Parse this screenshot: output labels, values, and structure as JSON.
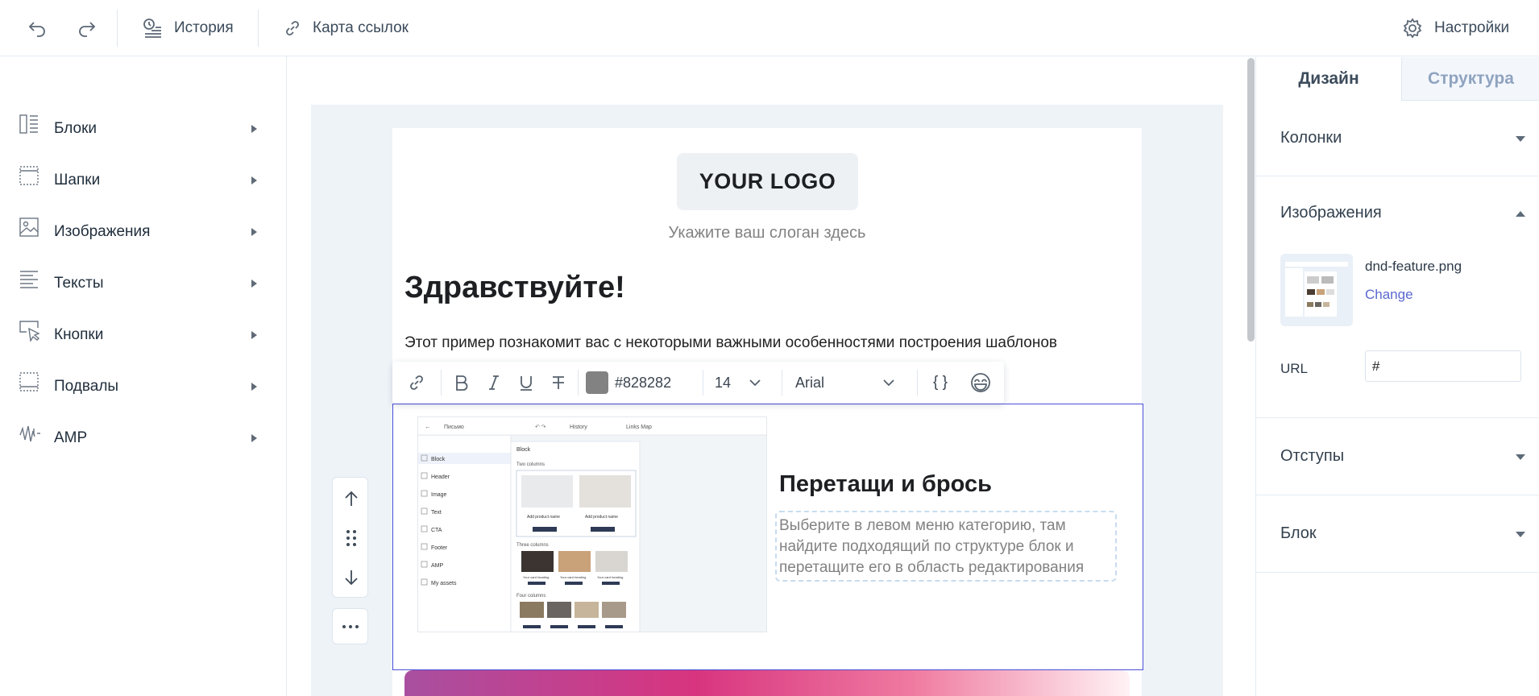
{
  "toolbar": {
    "undo_icon": "undo-icon",
    "redo_icon": "redo-icon",
    "history_label": "История",
    "links_map_label": "Карта ссылок",
    "settings_label": "Настройки"
  },
  "sidebar": {
    "items": [
      {
        "label": "Блоки",
        "icon": "blocks-icon"
      },
      {
        "label": "Шапки",
        "icon": "header-icon"
      },
      {
        "label": "Изображения",
        "icon": "image-icon"
      },
      {
        "label": "Тексты",
        "icon": "text-icon"
      },
      {
        "label": "Кнопки",
        "icon": "button-icon"
      },
      {
        "label": "Подвалы",
        "icon": "footer-icon"
      },
      {
        "label": "AMP",
        "icon": "amp-icon"
      }
    ]
  },
  "email": {
    "logo_text": "YOUR LOGO",
    "slogan": "Укажите ваш слоган здесь",
    "greeting": "Здравствуйте!",
    "intro": "Этот пример познакомит вас с некоторыми важными особенностями построения шаблонов",
    "dnd_title": "Перетащи и брось",
    "dnd_text": "Выберите в левом меню категорию, там найдите подходящий по структуре блок и перетащите его в область редактирования"
  },
  "text_toolbar": {
    "color_value": "#828282",
    "swatch_color": "#828282",
    "font_size": "14",
    "font_family": "Arial",
    "merge_tags_label": "{ }"
  },
  "preview_shot": {
    "title": "Письмо",
    "history": "History",
    "links_map": "Links Map",
    "menu": [
      "Block",
      "Header",
      "Image",
      "Text",
      "CTA",
      "Footer",
      "AMP",
      "My assets"
    ],
    "panel_title": "Block",
    "two_columns": "Two columns",
    "three_columns": "Three columns",
    "four_columns": "Four columns",
    "product_name": "Add product name",
    "card_heading": "Your card heading"
  },
  "right_panel": {
    "tabs": [
      "Дизайн",
      "Структура"
    ],
    "sections": {
      "columns": "Колонки",
      "images": "Изображения",
      "padding": "Отступы",
      "block": "Блок"
    },
    "image_file": "dnd-feature.png",
    "change_label": "Change",
    "url_label": "URL",
    "url_value": "#"
  },
  "colors": {
    "accent": "#4b4fd8",
    "link": "#5a68d0",
    "canvas_bg": "#eef3f8",
    "muted_text": "#828282"
  }
}
